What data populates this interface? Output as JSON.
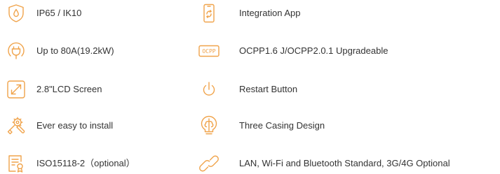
{
  "accent_color": "#f0a34a",
  "text_color": "#333333",
  "features_left": [
    {
      "icon": "shield-drop-icon",
      "label": "IP65 / IK10"
    },
    {
      "icon": "charging-plug-icon",
      "label": "Up to 80A(19.2kW)"
    },
    {
      "icon": "lcd-screen-icon",
      "label": "2.8\"LCD Screen"
    },
    {
      "icon": "wrench-tools-icon",
      "label": "Ever easy to install"
    },
    {
      "icon": "certificate-icon",
      "label": "ISO15118-2（optional）"
    }
  ],
  "features_right": [
    {
      "icon": "phone-app-icon",
      "label": "Integration App"
    },
    {
      "icon": "ocpp-badge-icon",
      "label": "OCPP1.6 J/OCPP2.0.1 Upgradeable",
      "badge_text": "OCPP"
    },
    {
      "icon": "power-button-icon",
      "label": "Restart Button"
    },
    {
      "icon": "brain-lightbulb-icon",
      "label": "Three Casing Design"
    },
    {
      "icon": "link-chain-icon",
      "label": "LAN, Wi-Fi and Bluetooth Standard, 3G/4G Optional"
    }
  ]
}
